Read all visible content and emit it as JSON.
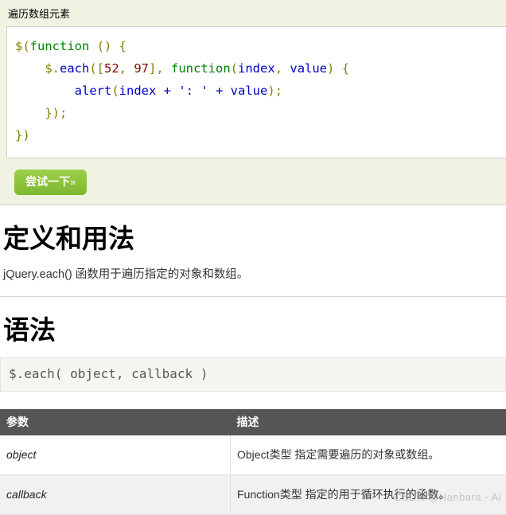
{
  "example": {
    "title": "遍历数组元素",
    "code_lines": [
      [
        {
          "t": "$(",
          "c": "tok-punc"
        },
        {
          "t": "function",
          "c": "tok-kw"
        },
        {
          "t": " () {",
          "c": "tok-punc"
        }
      ],
      [
        {
          "t": "    $.",
          "c": "tok-punc"
        },
        {
          "t": "each",
          "c": "tok-fn"
        },
        {
          "t": "([",
          "c": "tok-punc"
        },
        {
          "t": "52",
          "c": "tok-num"
        },
        {
          "t": ", ",
          "c": "tok-punc"
        },
        {
          "t": "97",
          "c": "tok-num"
        },
        {
          "t": "], ",
          "c": "tok-punc"
        },
        {
          "t": "function",
          "c": "tok-kw"
        },
        {
          "t": "(",
          "c": "tok-punc"
        },
        {
          "t": "index",
          "c": "tok-ident"
        },
        {
          "t": ", ",
          "c": "tok-punc"
        },
        {
          "t": "value",
          "c": "tok-ident"
        },
        {
          "t": ") {",
          "c": "tok-punc"
        }
      ],
      [
        {
          "t": "        ",
          "c": "tok-punc"
        },
        {
          "t": "alert",
          "c": "tok-fn"
        },
        {
          "t": "(",
          "c": "tok-punc"
        },
        {
          "t": "index",
          "c": "tok-ident"
        },
        {
          "t": " + ",
          "c": "tok-op"
        },
        {
          "t": "': '",
          "c": "tok-str"
        },
        {
          "t": " + ",
          "c": "tok-op"
        },
        {
          "t": "value",
          "c": "tok-ident"
        },
        {
          "t": ");",
          "c": "tok-punc"
        }
      ],
      [
        {
          "t": "    });",
          "c": "tok-punc"
        }
      ],
      [
        {
          "t": "})",
          "c": "tok-punc"
        }
      ]
    ],
    "try_button": {
      "label": "尝试一下",
      "chevron": "»"
    }
  },
  "definition": {
    "heading": "定义和用法",
    "description": "jQuery.each() 函数用于遍历指定的对象和数组。"
  },
  "syntax": {
    "heading": "语法",
    "signature": "$.each( object, callback )"
  },
  "params_table": {
    "headers": [
      "参数",
      "描述"
    ],
    "rows": [
      [
        "object",
        "Object类型 指定需要遍历的对象或数组。"
      ],
      [
        "callback",
        "Function类型 指定的用于循环执行的函数。"
      ]
    ]
  },
  "watermark": {
    "text": "CSDN @Hanbara - Ai"
  }
}
